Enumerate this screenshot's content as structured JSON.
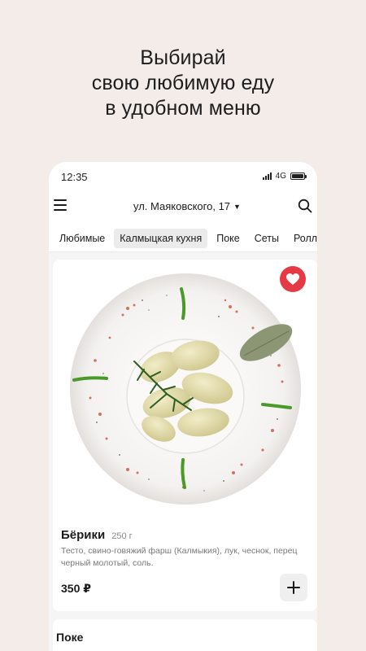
{
  "promo": {
    "line1": "Выбирай",
    "line2": "свою любимую еду",
    "line3": "в удобном меню"
  },
  "statusbar": {
    "time": "12:35",
    "network": "4G"
  },
  "header": {
    "menu_icon": "hamburger-menu-icon",
    "address": "ул. Маяковского, 17",
    "search_icon": "search-icon"
  },
  "tabs": [
    {
      "label": "Любимые",
      "active": false
    },
    {
      "label": "Калмыцкая кухня",
      "active": true
    },
    {
      "label": "Поке",
      "active": false
    },
    {
      "label": "Сеты",
      "active": false
    },
    {
      "label": "Роллы",
      "active": false
    }
  ],
  "product": {
    "name": "Бёрики",
    "weight": "250 г",
    "description": "Тесто, свино-говяжий фарш (Калмыкия), лук, чеснок, перец черный молотый, соль.",
    "price": "350 ₽",
    "favorite": true,
    "favorite_color": "#e63946",
    "add_icon": "plus-icon"
  },
  "next_section": {
    "title": "Поке"
  }
}
